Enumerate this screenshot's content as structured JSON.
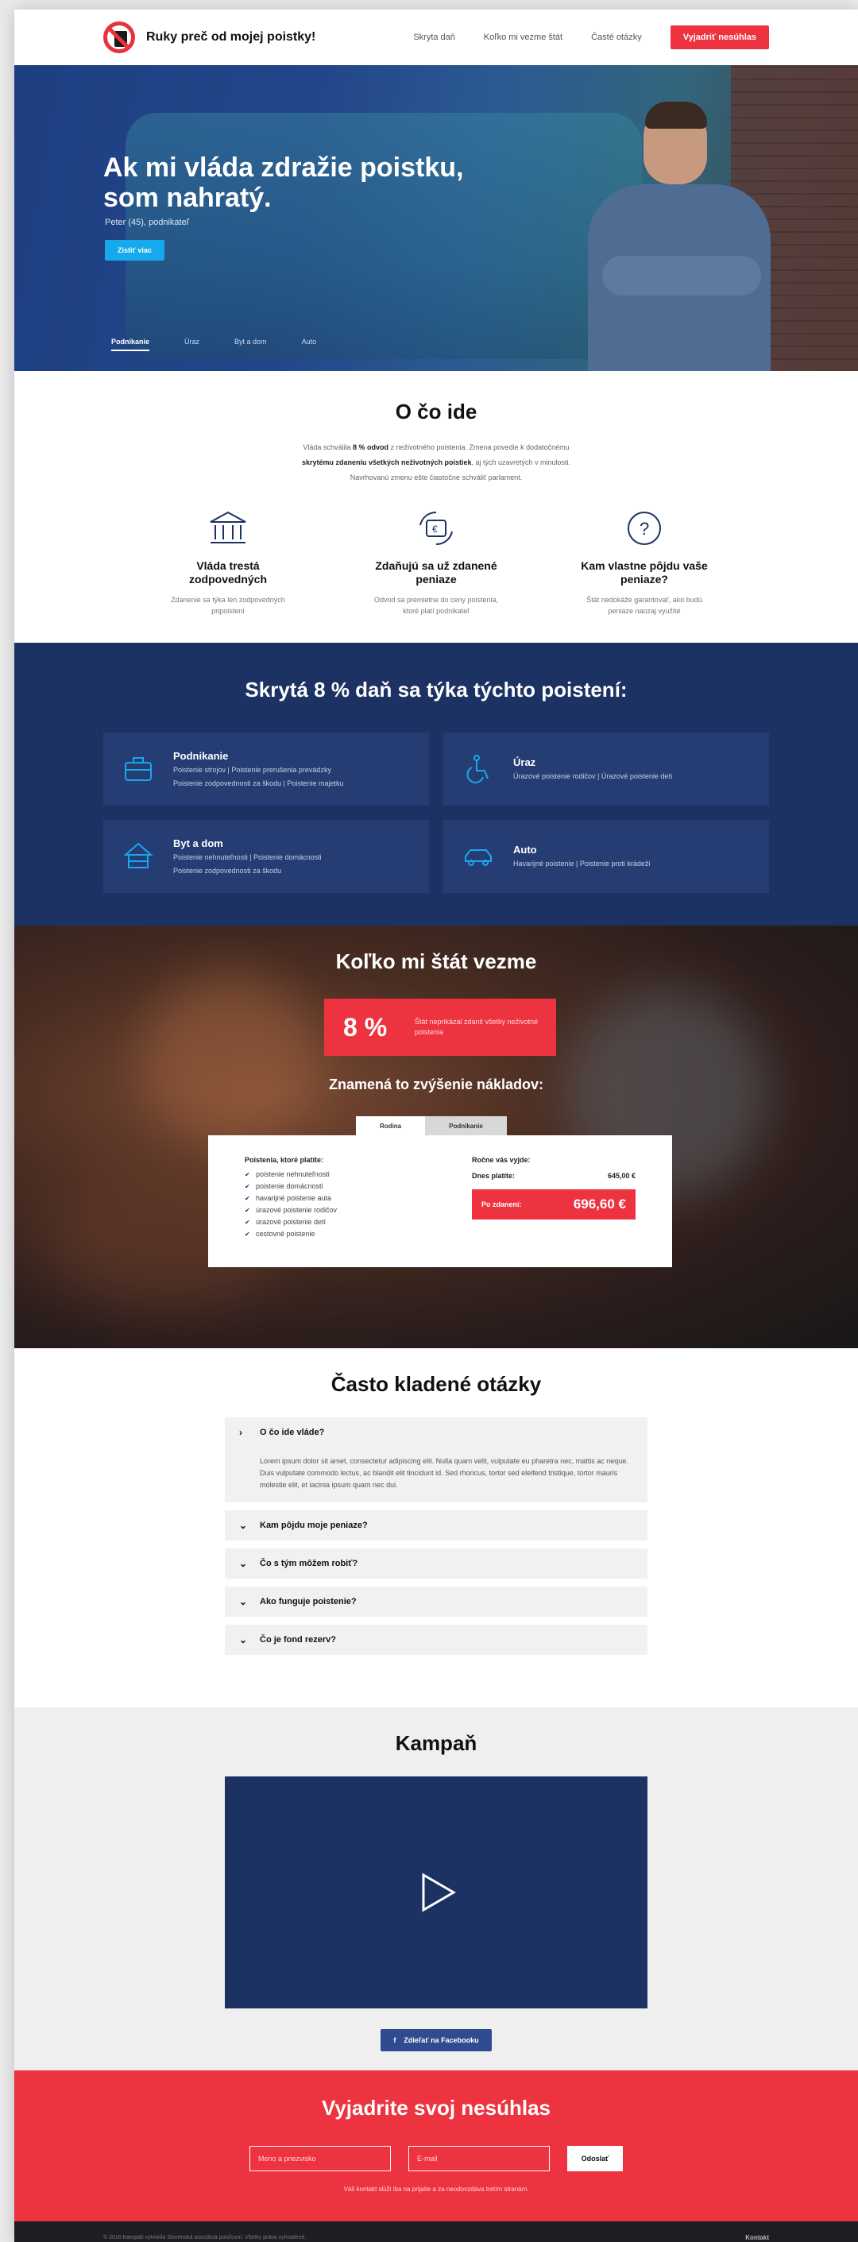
{
  "header": {
    "logo_text": "Ruky preč od mojej poistky!",
    "nav": [
      "Skryta daň",
      "Koľko mi vezme štát",
      "Časté otázky"
    ],
    "cta": "Vyjadriť nesúhlas"
  },
  "hero": {
    "title": "Ak mi vláda zdražie poistku, som nahratý.",
    "subtitle": "Peter (45), podnikateľ",
    "button": "Zistiť viac",
    "tabs": [
      "Podnikanie",
      "Úraz",
      "Byt a dom",
      "Auto"
    ],
    "active_tab": "Podnikanie"
  },
  "about": {
    "title": "O čo ide",
    "text_1": "Vláda schválila",
    "text_bold_1": "8 % odvod",
    "text_2": "z neživotného poistenia. Zmena povedie k dodatočnému",
    "text_bold_2": "skrytému zdaneniu všetkých neživotných poistiek",
    "text_3": ", aj tých uzavretých v minulosti.",
    "text_4": "Navrhovanú zmenu ešte čiastočne schváliť parlament.",
    "features": [
      {
        "icon": "bank-icon",
        "title": "Vláda trestá zodpovedných",
        "desc": "Zdanenie sa týka len zodpovedných pripoistení"
      },
      {
        "icon": "money-exchange-icon",
        "title": "Zdaňujú sa už zdanené peniaze",
        "desc": "Odvod sa premietne do ceny poistenia, ktoré platí podnikateľ"
      },
      {
        "icon": "question-icon",
        "title": "Kam vlastne pôjdu vaše peniaze?",
        "desc": "Štát nedokáže garantovať, ako budú peniaze naozaj využité"
      }
    ]
  },
  "tax": {
    "title": "Skrytá 8 % daň sa týka týchto poistení:",
    "cards": [
      {
        "icon": "briefcase-icon",
        "title": "Podnikanie",
        "l1": "Poistenie strojov | Poistenie prerušenia prevádzky",
        "l2": "Poistenie zodpovednosti za škodu | Poistenie majetku"
      },
      {
        "icon": "wheelchair-icon",
        "title": "Úraz",
        "l1": "Úrazové poistenie rodičov | Úrazové poistenie detí",
        "l2": ""
      },
      {
        "icon": "house-icon",
        "title": "Byt a dom",
        "l1": "Poistenie nehnuteľnosti | Poistenie domácnosti",
        "l2": "Poistenie zodpovednosti za škodu"
      },
      {
        "icon": "car-icon",
        "title": "Auto",
        "l1": "Havarijné poistenie | Poistenie proti krádeži",
        "l2": ""
      }
    ]
  },
  "calc": {
    "title": "Koľko mi štát vezme",
    "pct": "8 %",
    "pct_label": "Štát neprikázal zdanit všetky neživotné poistenia",
    "subtitle": "Znamená to zvýšenie nákladov:",
    "tabs": [
      "Rodina",
      "Podnikanie"
    ],
    "list_title": "Poistenia, ktoré platíte:",
    "items": [
      "poistenie nehnuteľnosti",
      "poistenie domácnosti",
      "havarijné poistenie auta",
      "úrazové poistenie rodičov",
      "úrazové poistenie detí",
      "cestovné poistenie"
    ],
    "annual_title": "Ročne vás vyjde:",
    "today_label": "Dnes platíte:",
    "today_value": "645,00 €",
    "after_label": "Po zdanení:",
    "after_value": "696,60 €"
  },
  "faq": {
    "title": "Často kladené otázky",
    "items": [
      {
        "q": "O čo ide vláde?",
        "a": "Lorem ipsum dolor sit amet, consectetur adipiscing elit. Nulla quam velit, vulputate eu pharetra nec, mattis ac neque. Duis vulputate commodo lectus, ac blandit elit tincidunt id. Sed rhoncus, tortor sed eleifend tristique, tortor mauris molestie elit, et lacinia ipsum quam nec dui."
      },
      {
        "q": "Kam pôjdu moje peniaze?",
        "a": ""
      },
      {
        "q": "Čo s tým môžem robiť?",
        "a": ""
      },
      {
        "q": "Ako funguje poistenie?",
        "a": ""
      },
      {
        "q": "Čo je fond rezerv?",
        "a": ""
      }
    ]
  },
  "campaign": {
    "title": "Kampaň",
    "fb_button": "Zdieľať na Facebooku"
  },
  "protest": {
    "title": "Vyjadrite svoj nesúhlas",
    "name_placeholder": "Meno a priezvisko",
    "email_placeholder": "E-mail",
    "submit": "Odoslať",
    "note": "Váš kontakt slúži iba na prijatie a za neodovzdáva tretím stranám."
  },
  "footer": {
    "copyright": "© 2016 Kampaň vytvorila Slovenská asociácia poisťovní. Všetky práva vyhradené.",
    "contact": "Kontakt"
  },
  "colors": {
    "red": "#ee3340",
    "navy": "#1c3263",
    "blue": "#17a9ee"
  }
}
